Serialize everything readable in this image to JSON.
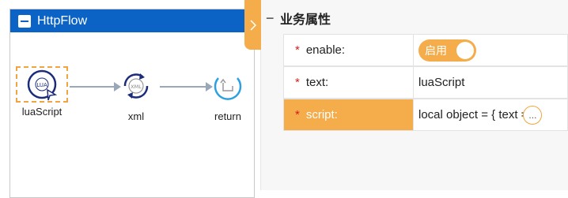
{
  "flow": {
    "title": "HttpFlow",
    "nodes": [
      {
        "label": "luaScript",
        "icon": "lua-script-icon"
      },
      {
        "label": "xml",
        "icon": "xml-icon"
      },
      {
        "label": "return",
        "icon": "return-icon"
      }
    ],
    "icon_text": {
      "lua": "LUA",
      "xml": "XML"
    }
  },
  "properties": {
    "section_title": "业务属性",
    "required_mark": "*",
    "rows": [
      {
        "key": "enable:",
        "toggle_label": "启用"
      },
      {
        "key": "text:",
        "value": "luaScript"
      },
      {
        "key": "script:",
        "value": "local object = { text =",
        "ellipsis": "..."
      }
    ]
  },
  "colors": {
    "header_blue": "#0b63c5",
    "accent_orange": "#f5ac4a",
    "required_red": "#d21f1f",
    "node_navy": "#1c2c7a",
    "return_blue": "#2ea0e0"
  }
}
